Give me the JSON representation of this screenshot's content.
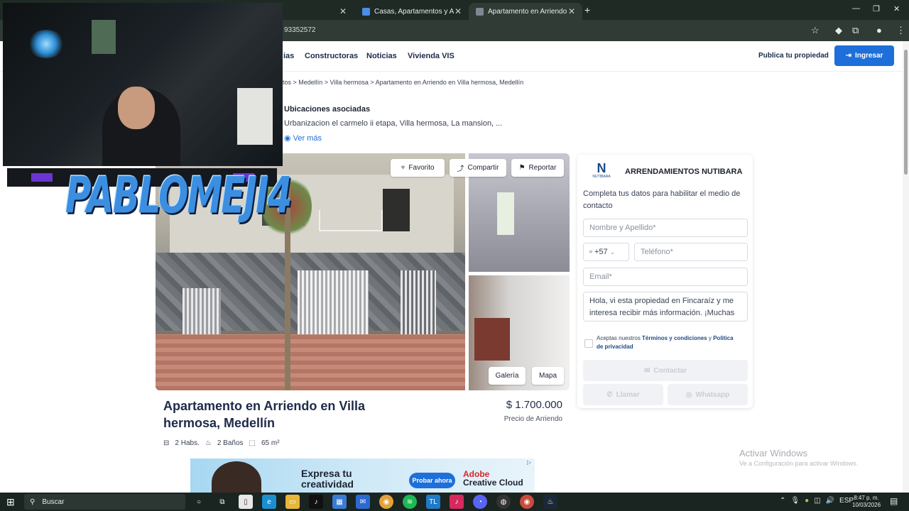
{
  "browser": {
    "tabs": [
      {
        "label": ""
      },
      {
        "label": "Casas, Apartamentos y Apartaes"
      },
      {
        "label": "Apartamento en Arriendo en Me"
      }
    ],
    "url": "93352572"
  },
  "site": {
    "nav": [
      "ias",
      "Constructoras",
      "Noticias",
      "Vivienda VIS"
    ],
    "publish": "Publica tu propiedad",
    "login": "Ingresar",
    "breadcrumb": "tos > Medellín > Villa hermosa > Apartamento en Arriendo en Villa hermosa, Medellín",
    "locations_title": "Ubicaciones asociadas",
    "locations_list": "Urbanizacion el carmelo ii etapa, Villa hermosa, La mansion, ...",
    "see_more": "Ver más"
  },
  "gallery": {
    "favorite": "Favorito",
    "share": "Compartir",
    "report": "Reportar",
    "gallery_btn": "Galería",
    "map_btn": "Mapa"
  },
  "property": {
    "title": "Apartamento en Arriendo en Villa hermosa, Medellín",
    "price": "$ 1.700.000",
    "price_label": "Precio de Arriendo",
    "rooms": "2 Habs.",
    "baths": "2 Baños",
    "area": "65 m²"
  },
  "contact": {
    "logo_letter": "N",
    "logo_sub": "NUTIBARA",
    "agency": "ARRENDAMIENTOS NUTIBARA",
    "description": "Completa tus datos para habilitar el medio de contacto",
    "name_placeholder": "Nombre y Apellido*",
    "country_code": "+57",
    "phone_placeholder": "Teléfono*",
    "email_placeholder": "Email*",
    "message": "Hola, vi esta propiedad en Fincaraíz y me interesa recibir más información. ¡Muchas",
    "terms_prefix": "Aceptas nuestros",
    "terms_link": "Términos y condiciones",
    "terms_and": "y",
    "privacy_link": "Política de privacidad",
    "contact_btn": "Contactar",
    "call_btn": "Llamar",
    "whatsapp_btn": "Whatsapp"
  },
  "ad": {
    "headline_1": "Expresa tu",
    "headline_2": "creatividad",
    "cta": "Probar ahora",
    "brand_1": "Adobe",
    "brand_2": "Creative Cloud"
  },
  "watermark": {
    "title": "Activar Windows",
    "subtitle": "Ve a Configuración para activar Windows."
  },
  "overlay": {
    "streamer_name": "PABLOMEJI4"
  },
  "taskbar": {
    "search": "Buscar",
    "lang": "ESP",
    "time": "8:47 p. m.",
    "date": "10/03/2026"
  },
  "colors": {
    "accent": "#1e6fd9",
    "dark_navy": "#1d2a4a"
  }
}
